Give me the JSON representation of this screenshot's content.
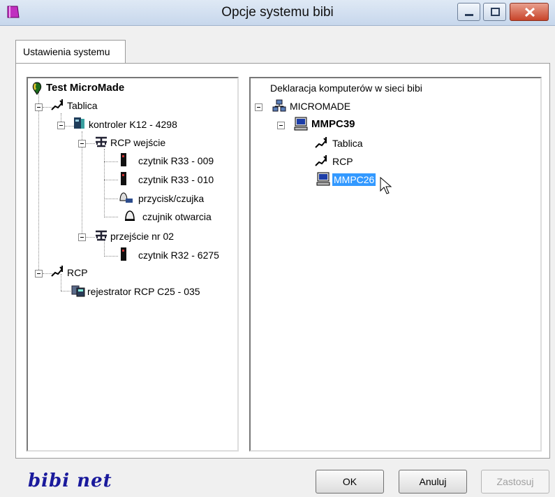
{
  "window": {
    "title": "Opcje systemu bibi"
  },
  "tabs": [
    {
      "label": "Ustawienia systemu",
      "active": true
    }
  ],
  "left_tree": {
    "root": "Test MicroMade",
    "nodes": [
      {
        "label": "Tablica",
        "icon": "bus-line-icon"
      },
      {
        "label": "kontroler K12 - 4298",
        "icon": "controller-icon"
      },
      {
        "label": "RCP wejście",
        "icon": "network-hub-icon"
      },
      {
        "label": "czytnik R33 - 009",
        "icon": "card-reader-icon"
      },
      {
        "label": "czytnik R33 - 010",
        "icon": "card-reader-icon"
      },
      {
        "label": "przycisk/czujka",
        "icon": "bell-button-icon"
      },
      {
        "label": "czujnik otwarcia",
        "icon": "bell-icon"
      },
      {
        "label": "przejście nr 02",
        "icon": "network-hub-icon"
      },
      {
        "label": "czytnik R32 - 6275",
        "icon": "card-reader-icon"
      },
      {
        "label": "RCP",
        "icon": "bus-line-icon"
      },
      {
        "label": "rejestrator RCP C25 - 035",
        "icon": "recorder-icon"
      }
    ]
  },
  "right_tree": {
    "header": "Deklaracja komputerów w sieci bibi",
    "nodes": [
      {
        "label": "MICROMADE",
        "icon": "network-icon"
      },
      {
        "label": "MMPC39",
        "icon": "computer-icon"
      },
      {
        "label": "Tablica",
        "icon": "bus-line-icon"
      },
      {
        "label": "RCP",
        "icon": "bus-line-icon"
      },
      {
        "label": "MMPC26",
        "icon": "computer-icon",
        "selected": true
      }
    ]
  },
  "footer": {
    "logo": "bibi net",
    "ok": "OK",
    "cancel": "Anuluj",
    "apply": "Zastosuj",
    "apply_enabled": false
  },
  "colors": {
    "selection": "#3399ff",
    "logo": "#1a1a9c",
    "close_button": "#c8442a"
  }
}
